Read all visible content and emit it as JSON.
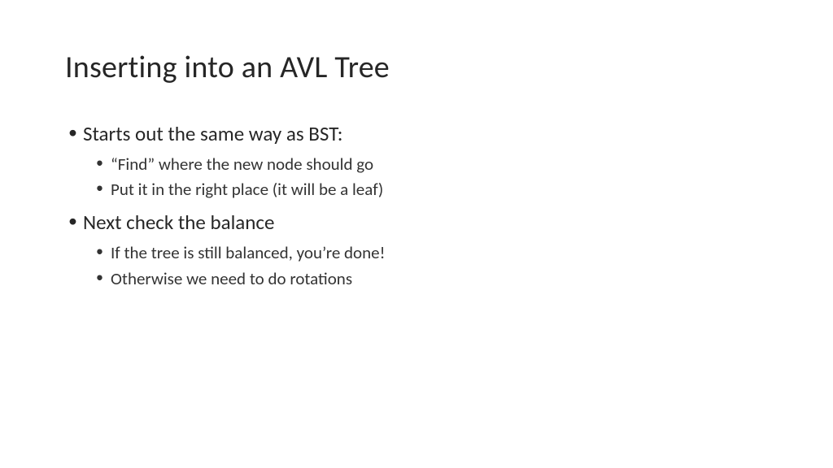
{
  "title": "Inserting into an AVL Tree",
  "bullets": [
    {
      "text": "Starts out the same way as BST:",
      "subitems": [
        "“Find” where the new node should go",
        "Put it in the right place (it will be a leaf)"
      ]
    },
    {
      "text": "Next check the balance",
      "subitems": [
        "If the tree is still balanced, you’re done!",
        "Otherwise we need to do rotations"
      ]
    }
  ]
}
